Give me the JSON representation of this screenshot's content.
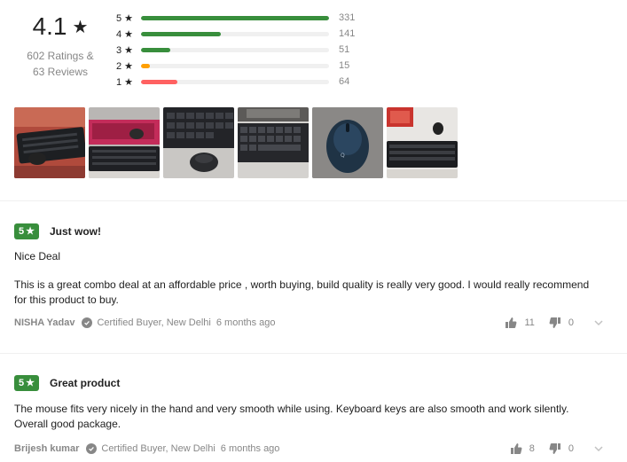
{
  "summary": {
    "average": "4.1",
    "star_glyph": "★",
    "ratings_text": "602 Ratings &",
    "reviews_text": "63 Reviews",
    "breakdown": [
      {
        "label": "5 ★",
        "count": "331",
        "fraction": 1.0,
        "color": "#388e3c"
      },
      {
        "label": "4 ★",
        "count": "141",
        "fraction": 0.426,
        "color": "#388e3c"
      },
      {
        "label": "3 ★",
        "count": "51",
        "fraction": 0.154,
        "color": "#388e3c"
      },
      {
        "label": "2 ★",
        "count": "15",
        "fraction": 0.045,
        "color": "#ff9f00"
      },
      {
        "label": "1 ★",
        "count": "64",
        "fraction": 0.193,
        "color": "#ff6161"
      }
    ]
  },
  "photos": [
    {
      "icon": "keyboard-mouse-photo"
    },
    {
      "icon": "keyboard-box-photo"
    },
    {
      "icon": "keyboard-mouse-closeup-photo"
    },
    {
      "icon": "keyboard-monitor-photo"
    },
    {
      "icon": "mouse-closeup-photo"
    },
    {
      "icon": "keyboard-mouse-desk-photo"
    }
  ],
  "reviews": [
    {
      "rating": "5",
      "title": "Just wow!",
      "subtitle": "Nice Deal",
      "text_line1": "This is a great combo deal at an affordable price , worth buying, build quality is really very good. I would really recommend",
      "text_line2": "for this product to buy.",
      "author": "NISHA Yadav",
      "location": "Certified Buyer, New Delhi",
      "time": "6 months ago",
      "likes": "11",
      "dislikes": "0"
    },
    {
      "rating": "5",
      "title": "Great product",
      "text_line1": "The mouse fits very nicely in the hand and very smooth while using. Keyboard keys are also smooth and work silently.",
      "text_line2": "Overall good package.",
      "author": "Brijesh kumar",
      "location": "Certified Buyer, New Delhi",
      "time": "6 months ago",
      "likes": "8",
      "dislikes": "0"
    }
  ],
  "colors": {
    "accent_green": "#388e3c",
    "muted": "#878787"
  }
}
